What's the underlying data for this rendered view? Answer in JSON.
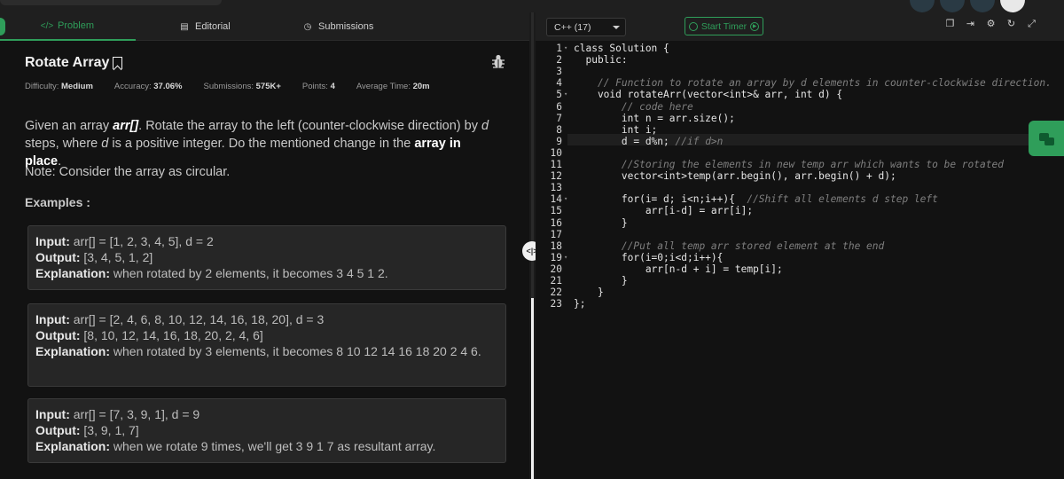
{
  "tabs": [
    {
      "label": "Problem",
      "icon": "code-icon"
    },
    {
      "label": "Editorial",
      "icon": "document-icon"
    },
    {
      "label": "Submissions",
      "icon": "clock-icon"
    }
  ],
  "problem": {
    "title": "Rotate Array",
    "meta": {
      "difficulty_label": "Difficulty:",
      "difficulty": "Medium",
      "accuracy_label": "Accuracy:",
      "accuracy": "37.06%",
      "submissions_label": "Submissions:",
      "submissions": "575K+",
      "points_label": "Points:",
      "points": "4",
      "time_label": "Average Time:",
      "time": "20m"
    },
    "desc_1": "Given an array ",
    "desc_arr": "arr[]",
    "desc_2": ". Rotate the array to the left (counter-clockwise direction) by ",
    "desc_d": "d",
    "desc_3": " steps, where ",
    "desc_d2": "d",
    "desc_4": " is a positive integer. Do the mentioned change in the ",
    "desc_bold": "array in place",
    "desc_5": ".",
    "note": "Note: Consider the array as circular.",
    "examples_label": "Examples :",
    "examples": [
      {
        "input_label": "Input:",
        "input": " arr[] = [1, 2, 3, 4, 5], d = 2",
        "output_label": "Output:",
        "output": " [3, 4, 5, 1, 2]",
        "expl_label": "Explanation:",
        "expl": " when rotated by 2 elements, it becomes 3 4 5 1 2."
      },
      {
        "input_label": "Input:",
        "input": " arr[] = [2, 4, 6, 8, 10, 12, 14, 16, 18, 20], d = 3",
        "output_label": "Output:",
        "output": " [8, 10, 12, 14, 16, 18, 20, 2, 4, 6]",
        "expl_label": "Explanation:",
        "expl": " when rotated by 3 elements, it becomes 8 10 12 14 16 18 20 2 4 6."
      },
      {
        "input_label": "Input:",
        "input": " arr[] = [7, 3, 9, 1], d = 9",
        "output_label": "Output:",
        "output": " [3, 9, 1, 7]",
        "expl_label": "Explanation:",
        "expl": " when we rotate 9 times, we'll get 3 9 1 7 as resultant array."
      }
    ]
  },
  "editor": {
    "language": "C++ (17)",
    "timer_label": "Start Timer",
    "accent": "#2f9e5a",
    "lines": [
      "class Solution {",
      "  public:",
      "",
      "    // Function to rotate an array by d elements in counter-clockwise direction.",
      "    void rotateArr(vector<int>& arr, int d) {",
      "        // code here",
      "        int n = arr.size();",
      "        int i;",
      "        d = d%n; //if d>n",
      "",
      "        //Storing the elements in new temp arr which wants to be rotated",
      "        vector<int>temp(arr.begin(), arr.begin() + d);",
      "",
      "        for(i= d; i<n;i++){  //Shift all elements d step left",
      "            arr[i-d] = arr[i];",
      "        }",
      "",
      "        //Put all temp arr stored element at the end",
      "        for(i=0;i<d;i++){",
      "            arr[n-d + i] = temp[i];",
      "        }",
      "    }",
      "};"
    ]
  }
}
